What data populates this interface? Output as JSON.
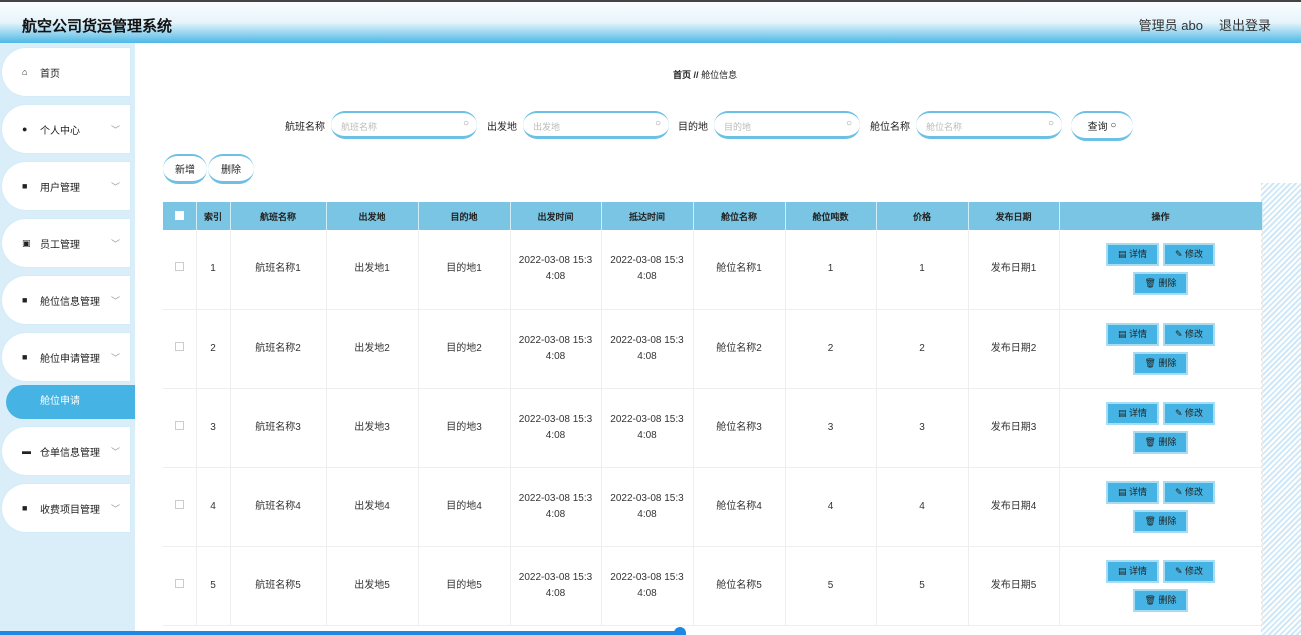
{
  "header": {
    "title": "航空公司货运管理系统",
    "user": "管理员 abo",
    "logout": "退出登录"
  },
  "sidebar": {
    "items": [
      {
        "label": "首页",
        "icon": "home-icon",
        "sym": "⌂"
      },
      {
        "label": "个人中心",
        "icon": "user-icon",
        "sym": "●"
      },
      {
        "label": "用户管理",
        "icon": "grid-icon",
        "sym": "■"
      },
      {
        "label": "员工管理",
        "icon": "clipboard-icon",
        "sym": "▣"
      },
      {
        "label": "舱位信息管理",
        "icon": "grid-icon",
        "sym": "■"
      },
      {
        "label": "舱位申请管理",
        "icon": "grid-icon",
        "sym": "■"
      },
      {
        "label": "仓单信息管理",
        "icon": "briefcase-icon",
        "sym": "▬"
      },
      {
        "label": "收费项目管理",
        "icon": "grid-icon",
        "sym": "■"
      }
    ],
    "active_sub": "舱位申请"
  },
  "breadcrumb": {
    "home": "首页",
    "sep": "//",
    "current": "舱位信息"
  },
  "search": {
    "fields": [
      {
        "label": "航班名称",
        "placeholder": "航班名称"
      },
      {
        "label": "出发地",
        "placeholder": "出发地"
      },
      {
        "label": "目的地",
        "placeholder": "目的地"
      },
      {
        "label": "舱位名称",
        "placeholder": "舱位名称"
      }
    ],
    "button": "查询"
  },
  "toolbar": {
    "add": "新增",
    "delete": "删除"
  },
  "table": {
    "headers": [
      "索引",
      "航班名称",
      "出发地",
      "目的地",
      "出发时间",
      "抵达时间",
      "舱位名称",
      "舱位吨数",
      "价格",
      "发布日期",
      "操作"
    ],
    "actions": {
      "detail": "详情",
      "edit": "修改",
      "delete": "删除"
    },
    "rows": [
      [
        "1",
        "航班名称1",
        "出发地1",
        "目的地1",
        "2022-03-08 15:34:08",
        "2022-03-08 15:34:08",
        "舱位名称1",
        "1",
        "1",
        "发布日期1"
      ],
      [
        "2",
        "航班名称2",
        "出发地2",
        "目的地2",
        "2022-03-08 15:34:08",
        "2022-03-08 15:34:08",
        "舱位名称2",
        "2",
        "2",
        "发布日期2"
      ],
      [
        "3",
        "航班名称3",
        "出发地3",
        "目的地3",
        "2022-03-08 15:34:08",
        "2022-03-08 15:34:08",
        "舱位名称3",
        "3",
        "3",
        "发布日期3"
      ],
      [
        "4",
        "航班名称4",
        "出发地4",
        "目的地4",
        "2022-03-08 15:34:08",
        "2022-03-08 15:34:08",
        "舱位名称4",
        "4",
        "4",
        "发布日期4"
      ],
      [
        "5",
        "航班名称5",
        "出发地5",
        "目的地5",
        "2022-03-08 15:34:08",
        "2022-03-08 15:34:08",
        "舱位名称5",
        "5",
        "5",
        "发布日期5"
      ]
    ]
  }
}
